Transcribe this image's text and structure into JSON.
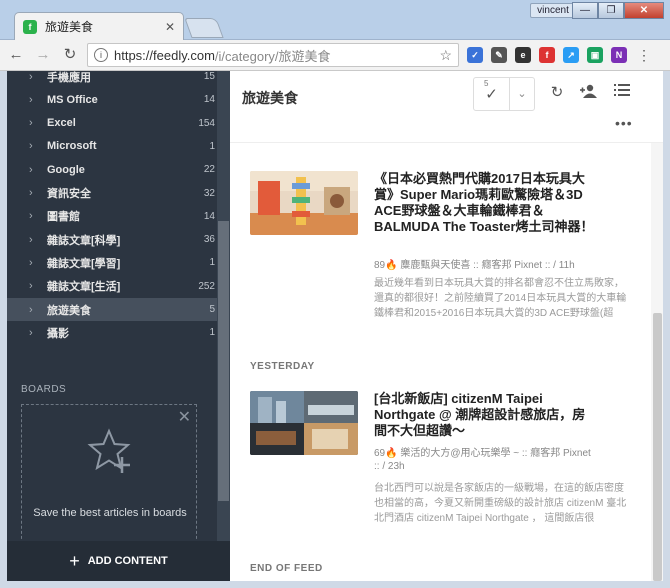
{
  "browser": {
    "tab_title": "旅遊美食",
    "tab_close": "✕",
    "user": "vincent",
    "url_main": "https://feedly.com",
    "url_rest": "/i/category/旅遊美食",
    "window_minimize": "—",
    "window_restore": "❐",
    "window_close": "✕"
  },
  "sidebar": {
    "categories": [
      {
        "name": "手機應用",
        "count": "15"
      },
      {
        "name": "MS Office",
        "count": "14"
      },
      {
        "name": "Excel",
        "count": "154"
      },
      {
        "name": "Microsoft",
        "count": "1"
      },
      {
        "name": "Google",
        "count": "22"
      },
      {
        "name": "資訊安全",
        "count": "32"
      },
      {
        "name": "圖書館",
        "count": "14"
      },
      {
        "name": "雜誌文章[科學]",
        "count": "36"
      },
      {
        "name": "雜誌文章[學習]",
        "count": "1"
      },
      {
        "name": "雜誌文章[生活]",
        "count": "252"
      },
      {
        "name": "旅遊美食",
        "count": "5"
      },
      {
        "name": "攝影",
        "count": "1"
      }
    ],
    "boards_label": "BOARDS",
    "boards_hint": "Save the best articles in boards",
    "add_content": "ADD CONTENT"
  },
  "main": {
    "title": "旅遊美食",
    "unread_count": "5",
    "articles": [
      {
        "title": "《日本必買熱門代購2017日本玩具大賞》Super Mario瑪莉歐驚險塔＆3D ACE野球盤＆大車輪鐵棒君＆BALMUDA The Toaster烤土司神器！",
        "meta": "89🔥 麋鹿甄與天使喜 :: 癮客邦 Pixnet :: / 11h",
        "snippet": "最近幾年看到日本玩具大賞的排名都會忍不住立馬敗家，還真的都很好！之前陸續買了2014日本玩具大賞的大車輪鐵棒君和2015+2016日本玩具大賞的3D ACE野球盤(超"
      },
      {
        "title": "[台北新飯店] citizenM Taipei Northgate @ 潮牌超設計感旅店，房間不大但超讚～",
        "meta": "69🔥 樂活的大方@用心玩樂學 ~ :: 癮客邦 Pixnet :: / 23h",
        "snippet": "台北西門可以說是各家飯店的一級戰場，在這的飯店密度也相當的高，今夏又新開重磅級的設計旅店 citizenM 臺北北門酒店 citizenM Taipei Northgate ， 這間飯店很"
      }
    ],
    "section_yesterday": "YESTERDAY",
    "end_of_feed": "END OF FEED"
  }
}
